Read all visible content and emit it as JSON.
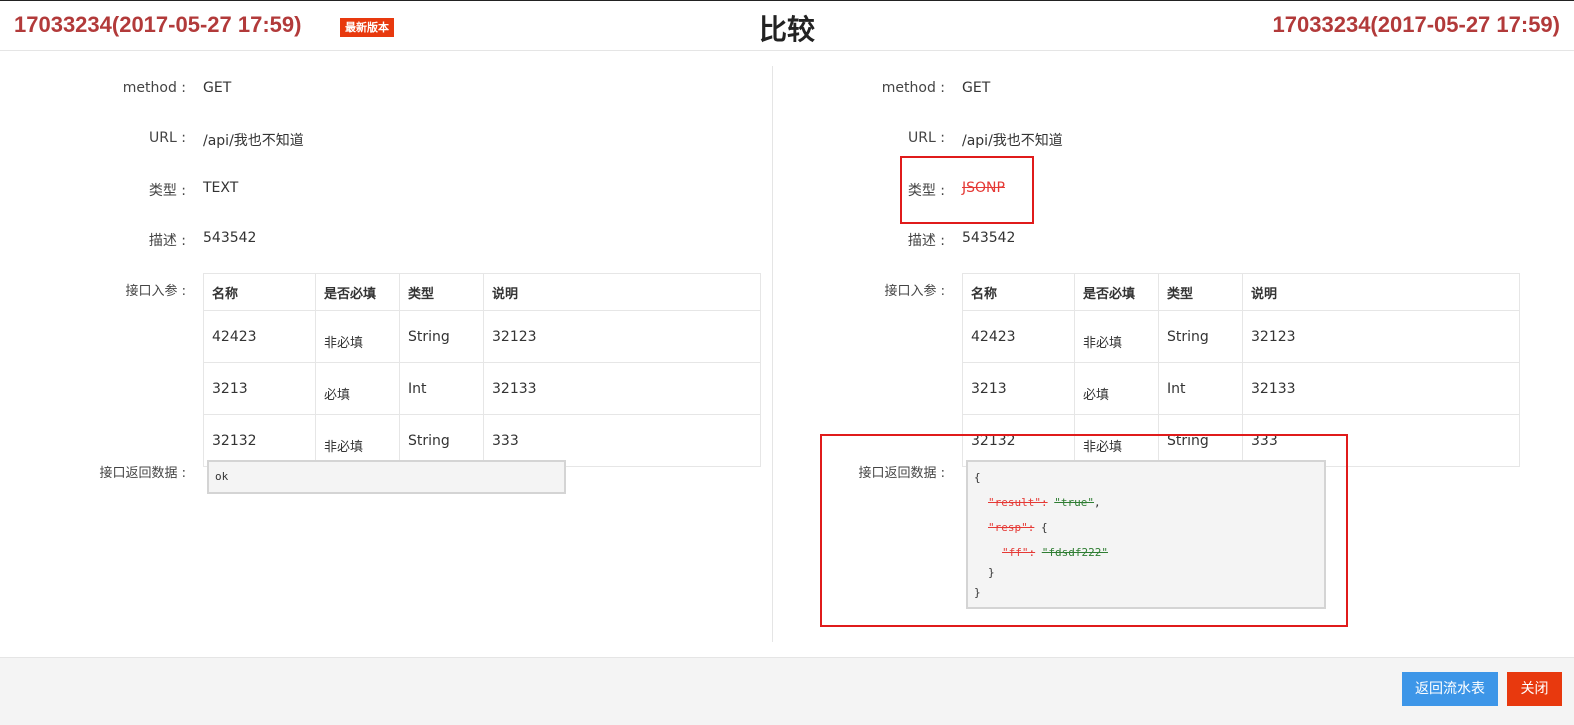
{
  "header": {
    "left_version": "17033234(2017-05-27 17:59)",
    "badge": "最新版本",
    "title": "比较",
    "right_version": "17033234(2017-05-27 17:59)"
  },
  "labels": {
    "method": "method :",
    "url": "URL :",
    "type": "类型 :",
    "desc": "描述 :",
    "params": "接口入参 :",
    "response": "接口返回数据 :"
  },
  "table_headers": [
    "名称",
    "是否必填",
    "类型",
    "说明"
  ],
  "left": {
    "method": "GET",
    "url": "/api/我也不知道",
    "type": "TEXT",
    "desc": "543542",
    "params": [
      [
        "42423",
        "非必填",
        "String",
        "32123"
      ],
      [
        "3213",
        "必填",
        "Int",
        "32133"
      ],
      [
        "32132",
        "非必填",
        "String",
        "333"
      ]
    ],
    "response": "ok"
  },
  "right": {
    "method": "GET",
    "url": "/api/我也不知道",
    "type": "JSONP",
    "desc": "543542",
    "params": [
      [
        "42423",
        "非必填",
        "String",
        "32123"
      ],
      [
        "3213",
        "必填",
        "Int",
        "32133"
      ],
      [
        "32132",
        "非必填",
        "String",
        "333"
      ]
    ],
    "response": {
      "open": "{",
      "result_key": "\"result\":",
      "result_val": "\"true\"",
      "comma": ",",
      "resp_key": "\"resp\":",
      "resp_open": "{",
      "ff_key": "\"ff\":",
      "ff_val": "\"fdsdf222\"",
      "resp_close": "}",
      "close": "}"
    }
  },
  "footer": {
    "back_button": "返回流水表",
    "close_button": "关闭"
  },
  "colors": {
    "version_text": "#b23a3a",
    "badge_bg": "#e8390e",
    "diff_removed": "#e53935",
    "diff_added": "#2e7d32",
    "primary_button": "#3d96e8",
    "close_button": "#e8390e"
  }
}
